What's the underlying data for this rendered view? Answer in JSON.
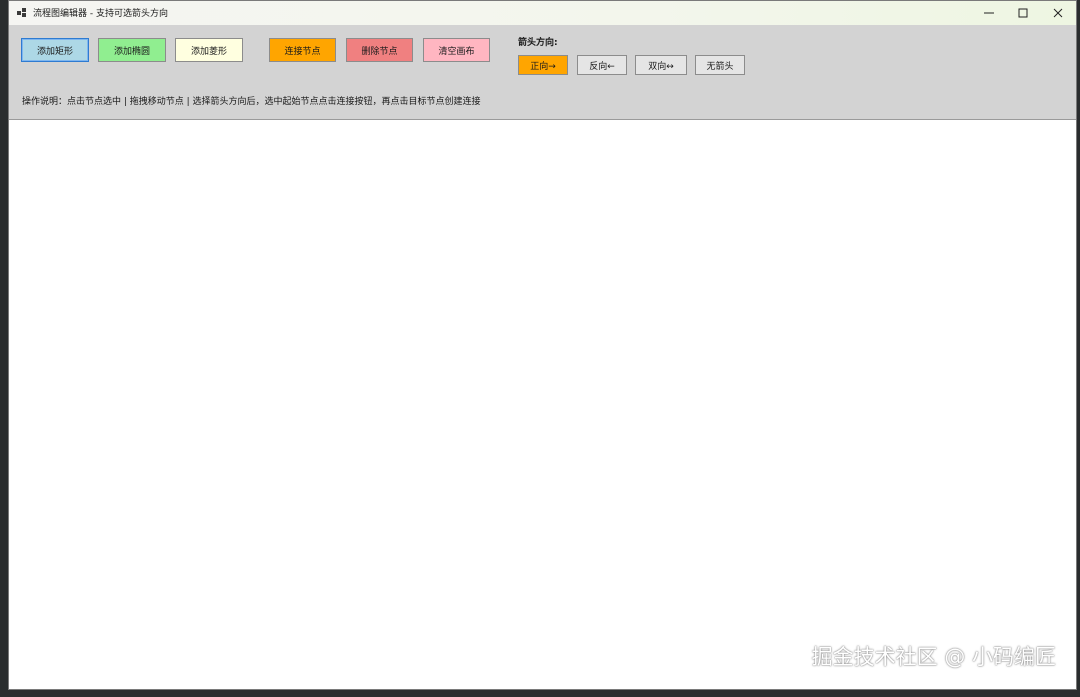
{
  "window": {
    "title": "流程图编辑器 - 支持可选箭头方向"
  },
  "toolbar": {
    "add_rect": "添加矩形",
    "add_ellipse": "添加椭圆",
    "add_diamond": "添加菱形",
    "connect_nodes": "连接节点",
    "delete_node": "删除节点",
    "clear_canvas": "清空画布",
    "arrow_direction_label": "箭头方向:",
    "dir_forward": "正向→",
    "dir_reverse": "反向←",
    "dir_both": "双向↔",
    "dir_none": "无箭头",
    "help": "操作说明：点击节点选中 | 拖拽移动节点 | 选择箭头方向后，选中起始节点点击连接按钮，再点击目标节点创建连接"
  },
  "watermark": "掘金技术社区 @ 小码编匠",
  "colors": {
    "add_rect_bg": "#add8e6",
    "add_ellipse_bg": "#90ee90",
    "add_diamond_bg": "#ffffe0",
    "connect_bg": "#ffa500",
    "delete_bg": "#f08080",
    "clear_bg": "#ffb6c1",
    "dir_forward_bg": "#ffa500",
    "toolbar_bg": "#d3d3d3",
    "canvas_bg": "#ffffff"
  },
  "icons": [
    "app-icon",
    "minimize-icon",
    "maximize-icon",
    "close-icon"
  ]
}
